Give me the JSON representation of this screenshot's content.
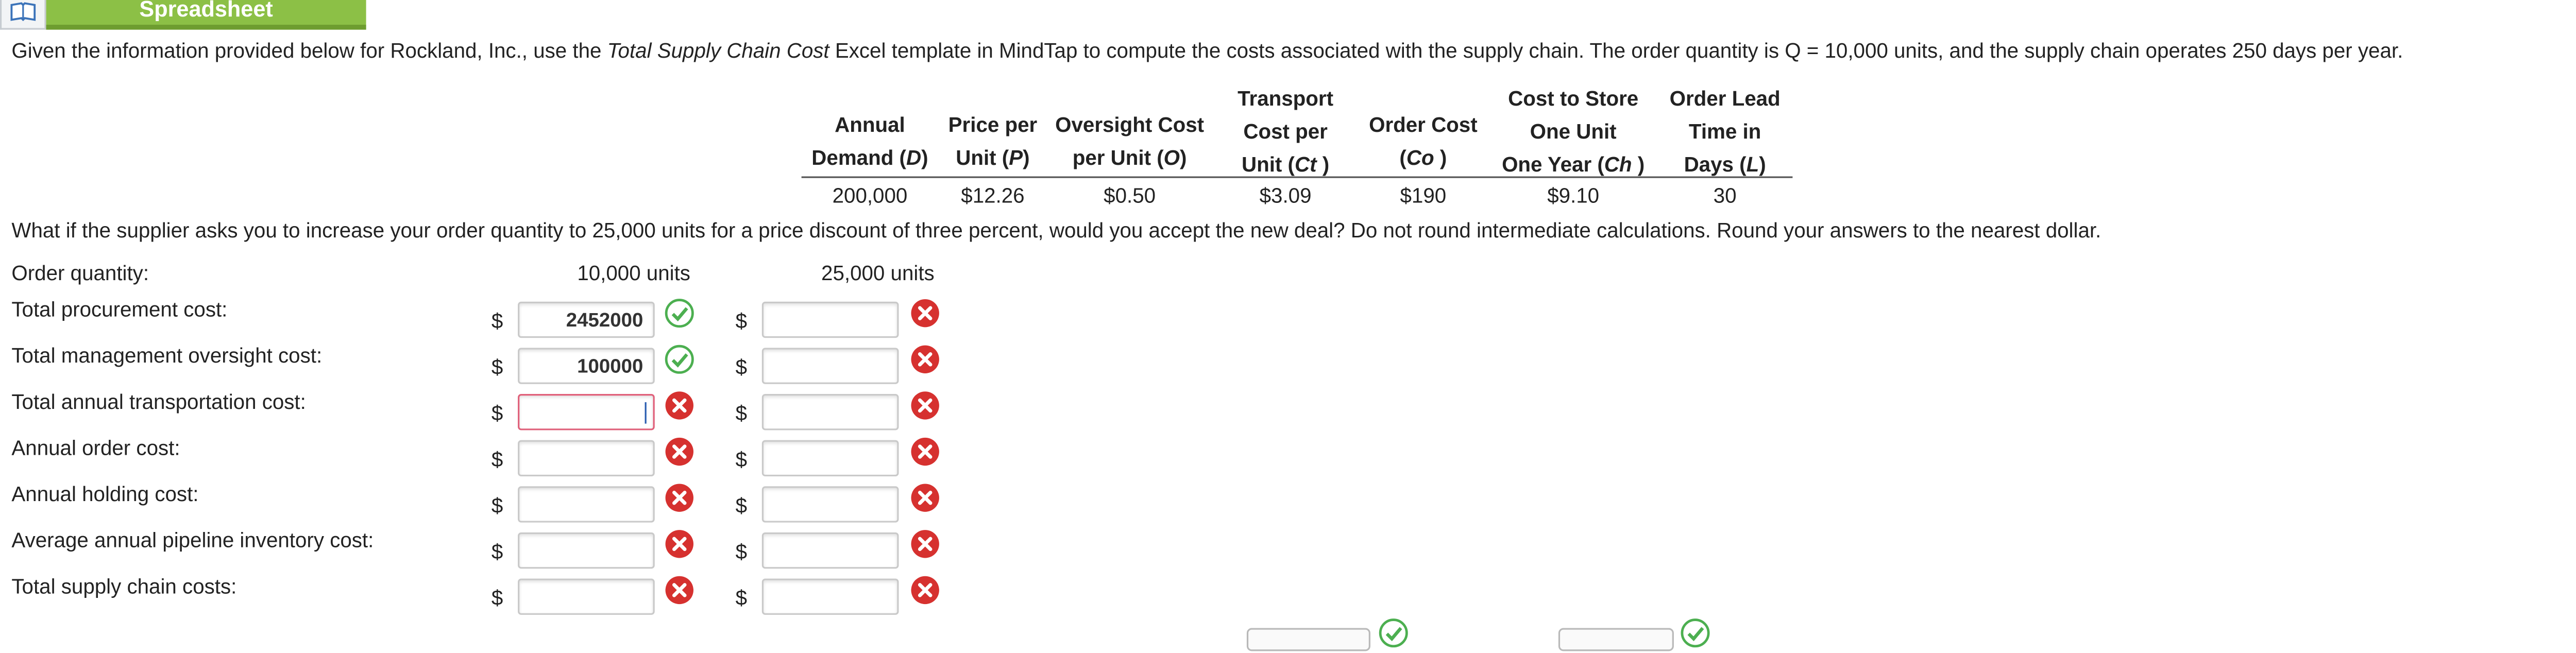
{
  "tab": {
    "label": "Spreadsheet",
    "icon": "book-icon"
  },
  "intro": {
    "part1": "Given the information provided below for Rockland, Inc., use the ",
    "template_name": "Total Supply Chain Cost",
    "part2": " Excel template in MindTap to compute the costs associated with the supply chain. The order quantity is Q = 10,000 units, and the supply chain operates 250 days per year."
  },
  "table": {
    "headers": {
      "demand": {
        "l1": "Annual",
        "l2a": "Demand (",
        "sym": "D",
        "l2b": ")"
      },
      "price": {
        "l1": "Price per",
        "l2a": "Unit (",
        "sym": "P",
        "l2b": ")"
      },
      "oversight": {
        "l1": "Oversight Cost",
        "l2a": "per Unit (",
        "sym": "O",
        "l2b": ")"
      },
      "transport": {
        "l1": "Transport",
        "l2": "Cost per",
        "l3a": "Unit (",
        "sym": "Ct",
        "l3b": " )"
      },
      "order": {
        "l1": "Order Cost",
        "l2a": "(",
        "sym": "Co",
        "l2b": " )"
      },
      "store": {
        "l1": "Cost to Store",
        "l2": "One Unit",
        "l3a": "One Year (",
        "sym": "Ch",
        "l3b": " )"
      },
      "lead": {
        "l1": "Order Lead",
        "l2": "Time in",
        "l3a": "Days (",
        "sym": "L",
        "l3b": ")"
      }
    },
    "values": {
      "demand": "200,000",
      "price": "$12.26",
      "oversight": "$0.50",
      "transport": "$3.09",
      "order": "$190",
      "store": "$9.10",
      "lead": "30"
    }
  },
  "question": "What if the supplier asks you to increase your order quantity to 25,000 units for a price discount of three percent, would you accept the new deal? Do not round intermediate calculations. Round your answers to the nearest dollar.",
  "form": {
    "order_quantity_label": "Order quantity:",
    "col1_head": "10,000 units",
    "col2_head": "25,000 units",
    "currency": "$",
    "rows": [
      {
        "label": "Total procurement cost:",
        "col1": "2452000",
        "col1_status": "correct",
        "col2": "",
        "col2_status": "incorrect"
      },
      {
        "label": "Total management oversight cost:",
        "col1": "100000",
        "col1_status": "correct",
        "col2": "",
        "col2_status": "incorrect"
      },
      {
        "label": "Total annual transportation cost:",
        "col1": "",
        "col1_status": "incorrect",
        "col2": "",
        "col2_status": "incorrect"
      },
      {
        "label": "Annual order cost:",
        "col1": "",
        "col1_status": "incorrect",
        "col2": "",
        "col2_status": "incorrect"
      },
      {
        "label": "Annual holding cost:",
        "col1": "",
        "col1_status": "incorrect",
        "col2": "",
        "col2_status": "incorrect"
      },
      {
        "label": "Average annual pipeline inventory cost:",
        "col1": "",
        "col1_status": "incorrect",
        "col2": "",
        "col2_status": "incorrect"
      },
      {
        "label": "Total supply chain costs:",
        "col1": "",
        "col1_status": "incorrect",
        "col2": "",
        "col2_status": "incorrect"
      }
    ]
  },
  "colors": {
    "correct": "#4caf50",
    "incorrect": "#d6312f",
    "tab": "#8cc046",
    "active_border": "#e0607a"
  }
}
